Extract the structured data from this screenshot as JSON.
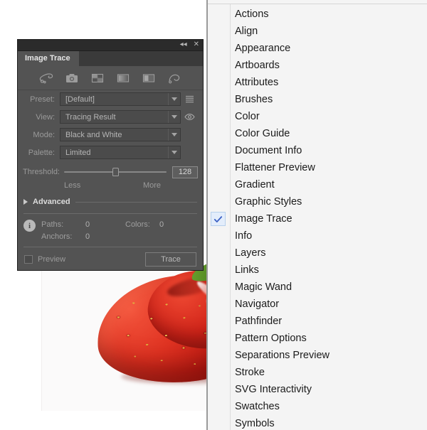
{
  "document": {
    "artwork_name": "strawberry-photo",
    "canvas_background": "#fbfafa"
  },
  "image_trace_panel": {
    "title": "Image Trace",
    "tab_label": "Image Trace",
    "titlebar": {
      "collapse_label": "◂◂",
      "close_label": "✕"
    },
    "toolbar": {
      "presets": [
        {
          "name": "auto-color-icon",
          "tooltip": "Auto-Color"
        },
        {
          "name": "high-color-icon",
          "tooltip": "High Color"
        },
        {
          "name": "low-color-icon",
          "tooltip": "Low Color"
        },
        {
          "name": "grayscale-icon",
          "tooltip": "Grayscale"
        },
        {
          "name": "black-and-white-icon",
          "tooltip": "Black and White"
        },
        {
          "name": "outline-icon",
          "tooltip": "Outline"
        }
      ]
    },
    "fields": {
      "preset": {
        "label": "Preset:",
        "value": "[Default]"
      },
      "view": {
        "label": "View:",
        "value": "Tracing Result"
      },
      "mode": {
        "label": "Mode:",
        "value": "Black and White"
      },
      "palette": {
        "label": "Palette:",
        "value": "Limited"
      }
    },
    "threshold": {
      "label": "Threshold:",
      "value": "128",
      "min_label": "Less",
      "max_label": "More",
      "percent": 50
    },
    "advanced": {
      "label": "Advanced",
      "expanded": false
    },
    "info": {
      "paths_label": "Paths:",
      "paths_value": "0",
      "anchors_label": "Anchors:",
      "anchors_value": "0",
      "colors_label": "Colors:",
      "colors_value": "0",
      "info_glyph": "i"
    },
    "footer": {
      "preview_label": "Preview",
      "preview_checked": false,
      "trace_label": "Trace"
    },
    "colors": {
      "panel_bg": "#535353",
      "titlebar_bg": "#2b2b2b",
      "field_bg": "#4b4b4b",
      "text": "#b5b5b5"
    }
  },
  "window_menu": {
    "items": [
      {
        "label": "Actions",
        "checked": false
      },
      {
        "label": "Align",
        "checked": false
      },
      {
        "label": "Appearance",
        "checked": false
      },
      {
        "label": "Artboards",
        "checked": false
      },
      {
        "label": "Attributes",
        "checked": false
      },
      {
        "label": "Brushes",
        "checked": false
      },
      {
        "label": "Color",
        "checked": false
      },
      {
        "label": "Color Guide",
        "checked": false
      },
      {
        "label": "Document Info",
        "checked": false
      },
      {
        "label": "Flattener Preview",
        "checked": false
      },
      {
        "label": "Gradient",
        "checked": false
      },
      {
        "label": "Graphic Styles",
        "checked": false
      },
      {
        "label": "Image Trace",
        "checked": true
      },
      {
        "label": "Info",
        "checked": false
      },
      {
        "label": "Layers",
        "checked": false
      },
      {
        "label": "Links",
        "checked": false
      },
      {
        "label": "Magic Wand",
        "checked": false
      },
      {
        "label": "Navigator",
        "checked": false
      },
      {
        "label": "Pathfinder",
        "checked": false
      },
      {
        "label": "Pattern Options",
        "checked": false
      },
      {
        "label": "Separations Preview",
        "checked": false
      },
      {
        "label": "Stroke",
        "checked": false
      },
      {
        "label": "SVG Interactivity",
        "checked": false
      },
      {
        "label": "Swatches",
        "checked": false
      },
      {
        "label": "Symbols",
        "checked": false
      }
    ],
    "check_accent": "#3a5fc4",
    "check_bg": "#e3edfb"
  }
}
